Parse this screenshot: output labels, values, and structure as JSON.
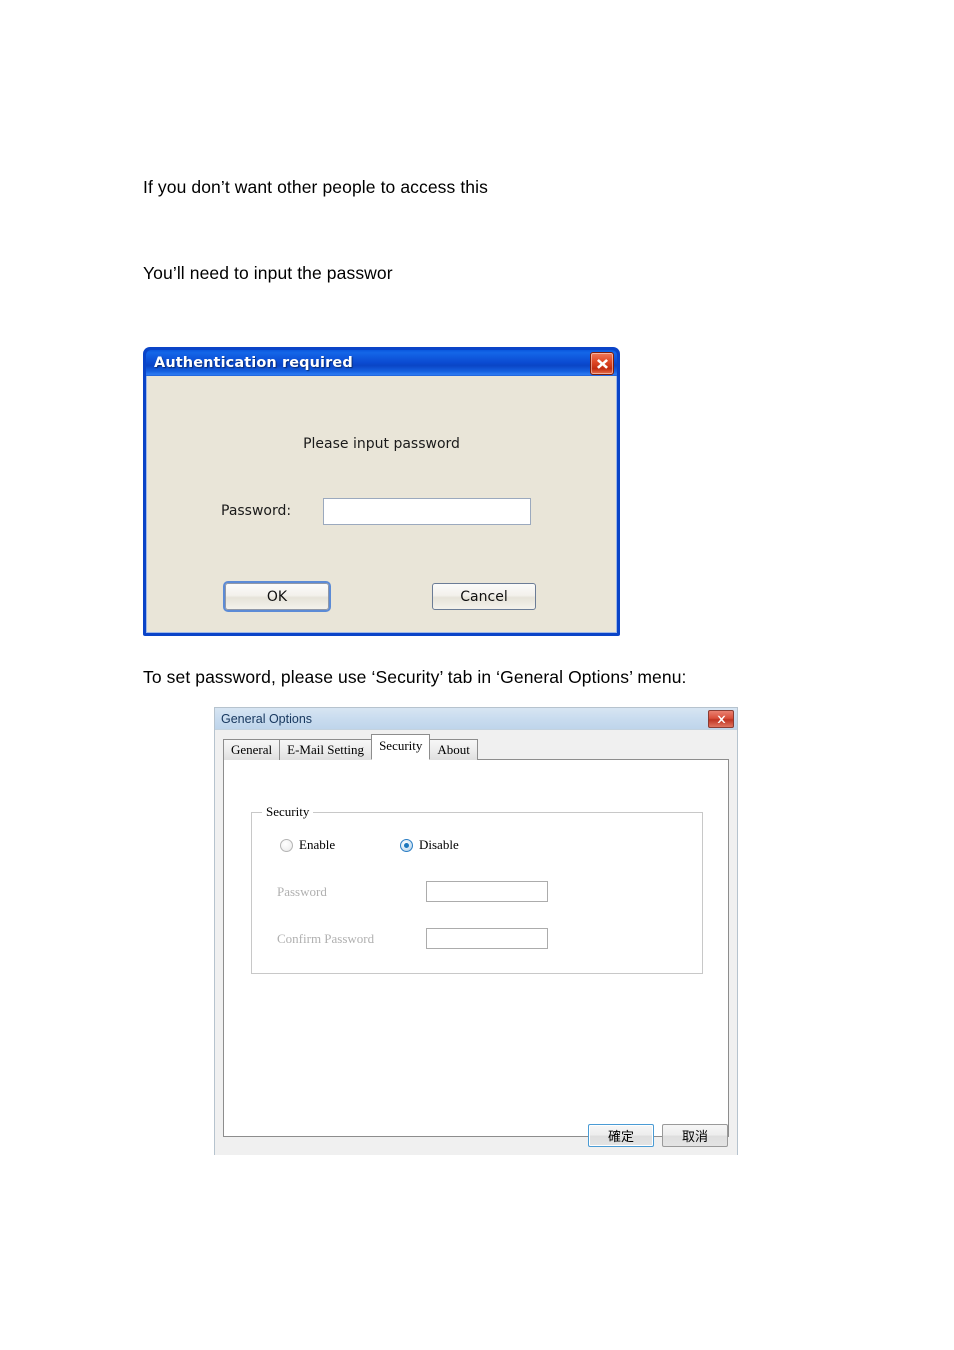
{
  "document": {
    "paragraph_1": "If you don’t want other people to access this",
    "paragraph_2": "You’ll need to input the passwor",
    "paragraph_3": "To set password, please use ‘Security’ tab in ‘General Options’ menu:"
  },
  "auth_dialog": {
    "title": "Authentication required",
    "close_icon": "close-icon",
    "prompt": "Please input password",
    "password_label": "Password:",
    "password_value": "",
    "password_placeholder": "",
    "ok_label": "OK",
    "cancel_label": "Cancel",
    "colors": {
      "titlebar": "#0B4BD2",
      "frame": "#0A44C8",
      "body": "#E9E5D8",
      "close_button": "#D9432A",
      "focus_ring": "#5C8BD6"
    }
  },
  "general_options_dialog": {
    "title": "General Options",
    "close_icon": "close-icon",
    "tabs": [
      {
        "label": "General",
        "active": false
      },
      {
        "label": "E-Mail Setting",
        "active": false
      },
      {
        "label": "Security",
        "active": true
      },
      {
        "label": "About",
        "active": false
      }
    ],
    "security_group": {
      "legend": "Security",
      "radios": [
        {
          "label": "Enable",
          "checked": false
        },
        {
          "label": "Disable",
          "checked": true
        }
      ],
      "fields": [
        {
          "label": "Password",
          "value": "",
          "disabled": true
        },
        {
          "label": "Confirm Password",
          "value": "",
          "disabled": true
        }
      ]
    },
    "footer": {
      "ok_label": "確定",
      "cancel_label": "取消"
    },
    "colors": {
      "titlebar": "#C9DCEF",
      "title_text": "#17375E",
      "body": "#F0F0F0",
      "panel": "#FFFFFF",
      "close_button": "#BF3422",
      "default_button_border": "#4A9BD4",
      "disabled_label": "#B0B0B0",
      "radio_accent": "#1B76BD"
    }
  }
}
